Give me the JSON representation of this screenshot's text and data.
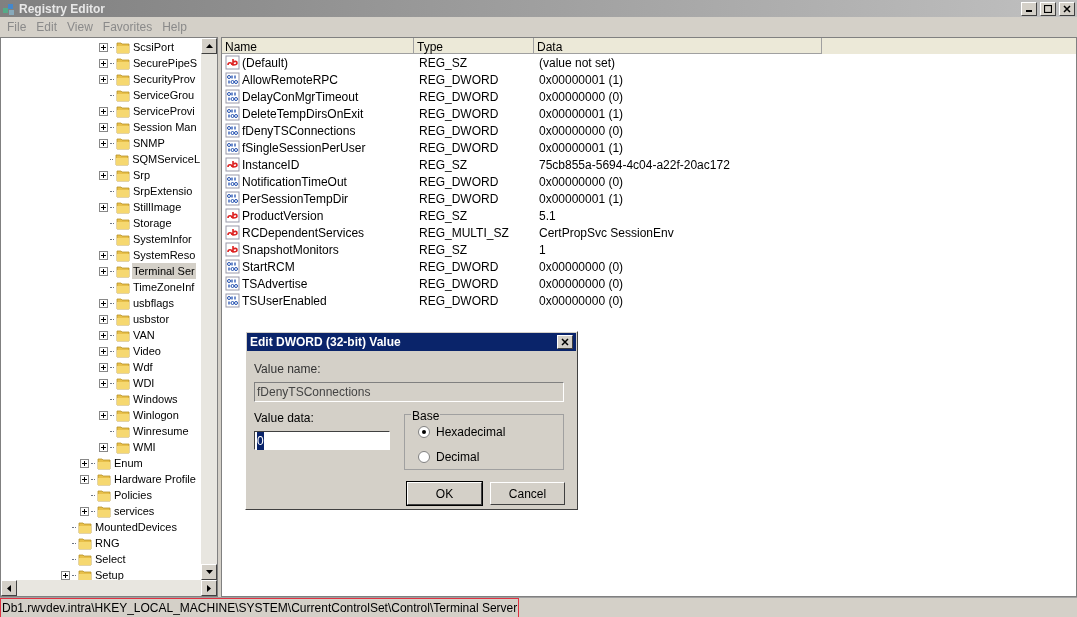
{
  "window": {
    "title": "Registry Editor"
  },
  "menu": [
    {
      "label": "File",
      "disabled": true
    },
    {
      "label": "Edit",
      "disabled": true
    },
    {
      "label": "View",
      "disabled": true
    },
    {
      "label": "Favorites",
      "disabled": true
    },
    {
      "label": "Help",
      "disabled": true
    }
  ],
  "tree": {
    "items": [
      {
        "children": [
          {
            "children": [
              {
                "label": "ScsiPort",
                "expandable": true,
                "selected": false
              },
              {
                "label": "SecurePipeS",
                "expandable": true,
                "selected": false
              },
              {
                "label": "SecurityProv",
                "expandable": true,
                "selected": false
              },
              {
                "label": "ServiceGrou",
                "expandable": false,
                "selected": false
              },
              {
                "label": "ServiceProvi",
                "expandable": true,
                "selected": false
              },
              {
                "label": "Session Man",
                "expandable": true,
                "selected": false
              },
              {
                "label": "SNMP",
                "expandable": true,
                "selected": false
              },
              {
                "label": "SQMServiceL",
                "expandable": false,
                "selected": false
              },
              {
                "label": "Srp",
                "expandable": true,
                "selected": false
              },
              {
                "label": "SrpExtensio",
                "expandable": false,
                "selected": false
              },
              {
                "label": "StillImage",
                "expandable": true,
                "selected": false
              },
              {
                "label": "Storage",
                "expandable": false,
                "selected": false
              },
              {
                "label": "SystemInfor",
                "expandable": false,
                "selected": false
              },
              {
                "label": "SystemReso",
                "expandable": true,
                "selected": false
              },
              {
                "label": "Terminal Ser",
                "expandable": true,
                "selected": true
              },
              {
                "label": "TimeZoneInf",
                "expandable": false,
                "selected": false
              },
              {
                "label": "usbflags",
                "expandable": true,
                "selected": false
              },
              {
                "label": "usbstor",
                "expandable": true,
                "selected": false
              },
              {
                "label": "VAN",
                "expandable": true,
                "selected": false
              },
              {
                "label": "Video",
                "expandable": true,
                "selected": false
              },
              {
                "label": "Wdf",
                "expandable": true,
                "selected": false
              },
              {
                "label": "WDI",
                "expandable": true,
                "selected": false
              },
              {
                "label": "Windows",
                "expandable": false,
                "selected": false
              },
              {
                "label": "Winlogon",
                "expandable": true,
                "selected": false
              },
              {
                "label": "Winresume",
                "expandable": false,
                "selected": false
              },
              {
                "label": "WMI",
                "expandable": true,
                "selected": false
              }
            ]
          },
          {
            "label": "Enum",
            "expandable": true,
            "selected": false
          },
          {
            "label": "Hardware Profile",
            "expandable": true,
            "selected": false
          },
          {
            "label": "Policies",
            "expandable": false,
            "selected": false
          },
          {
            "label": "services",
            "expandable": true,
            "selected": false
          }
        ]
      },
      {
        "label": "MountedDevices",
        "expandable": false,
        "selected": false
      },
      {
        "label": "RNG",
        "expandable": false,
        "selected": false
      },
      {
        "label": "Select",
        "expandable": false,
        "selected": false
      },
      {
        "label": "Setup",
        "expandable": true,
        "selected": false
      }
    ]
  },
  "values": {
    "columns": [
      "Name",
      "Type",
      "Data"
    ],
    "rows": [
      {
        "kind": "string",
        "name": "(Default)",
        "type": "REG_SZ",
        "data": "(value not set)"
      },
      {
        "kind": "binary",
        "name": "AllowRemoteRPC",
        "type": "REG_DWORD",
        "data": "0x00000001 (1)"
      },
      {
        "kind": "binary",
        "name": "DelayConMgrTimeout",
        "type": "REG_DWORD",
        "data": "0x00000000 (0)"
      },
      {
        "kind": "binary",
        "name": "DeleteTempDirsOnExit",
        "type": "REG_DWORD",
        "data": "0x00000001 (1)"
      },
      {
        "kind": "binary",
        "name": "fDenyTSConnections",
        "type": "REG_DWORD",
        "data": "0x00000000 (0)"
      },
      {
        "kind": "binary",
        "name": "fSingleSessionPerUser",
        "type": "REG_DWORD",
        "data": "0x00000001 (1)"
      },
      {
        "kind": "string",
        "name": "InstanceID",
        "type": "REG_SZ",
        "data": "75cb855a-5694-4c04-a22f-20ac172"
      },
      {
        "kind": "binary",
        "name": "NotificationTimeOut",
        "type": "REG_DWORD",
        "data": "0x00000000 (0)"
      },
      {
        "kind": "binary",
        "name": "PerSessionTempDir",
        "type": "REG_DWORD",
        "data": "0x00000001 (1)"
      },
      {
        "kind": "string",
        "name": "ProductVersion",
        "type": "REG_SZ",
        "data": "5.1"
      },
      {
        "kind": "string",
        "name": "RCDependentServices",
        "type": "REG_MULTI_SZ",
        "data": "CertPropSvc SessionEnv"
      },
      {
        "kind": "string",
        "name": "SnapshotMonitors",
        "type": "REG_SZ",
        "data": "1"
      },
      {
        "kind": "binary",
        "name": "StartRCM",
        "type": "REG_DWORD",
        "data": "0x00000000 (0)"
      },
      {
        "kind": "binary",
        "name": "TSAdvertise",
        "type": "REG_DWORD",
        "data": "0x00000000 (0)"
      },
      {
        "kind": "binary",
        "name": "TSUserEnabled",
        "type": "REG_DWORD",
        "data": "0x00000000 (0)"
      }
    ]
  },
  "dialog": {
    "title": "Edit DWORD (32-bit) Value",
    "value_name_label": "Value name:",
    "value_name": "fDenyTSConnections",
    "value_data_label": "Value data:",
    "value_data": "0",
    "base_label": "Base",
    "base_options": [
      {
        "label": "Hexadecimal",
        "selected": true
      },
      {
        "label": "Decimal",
        "selected": false
      }
    ],
    "buttons": [
      "OK",
      "Cancel"
    ]
  },
  "status_bar": {
    "path": "Db1.rwvdev.intra\\HKEY_LOCAL_MACHINE\\SYSTEM\\CurrentControlSet\\Control\\Terminal Server",
    "highlighted": true
  }
}
